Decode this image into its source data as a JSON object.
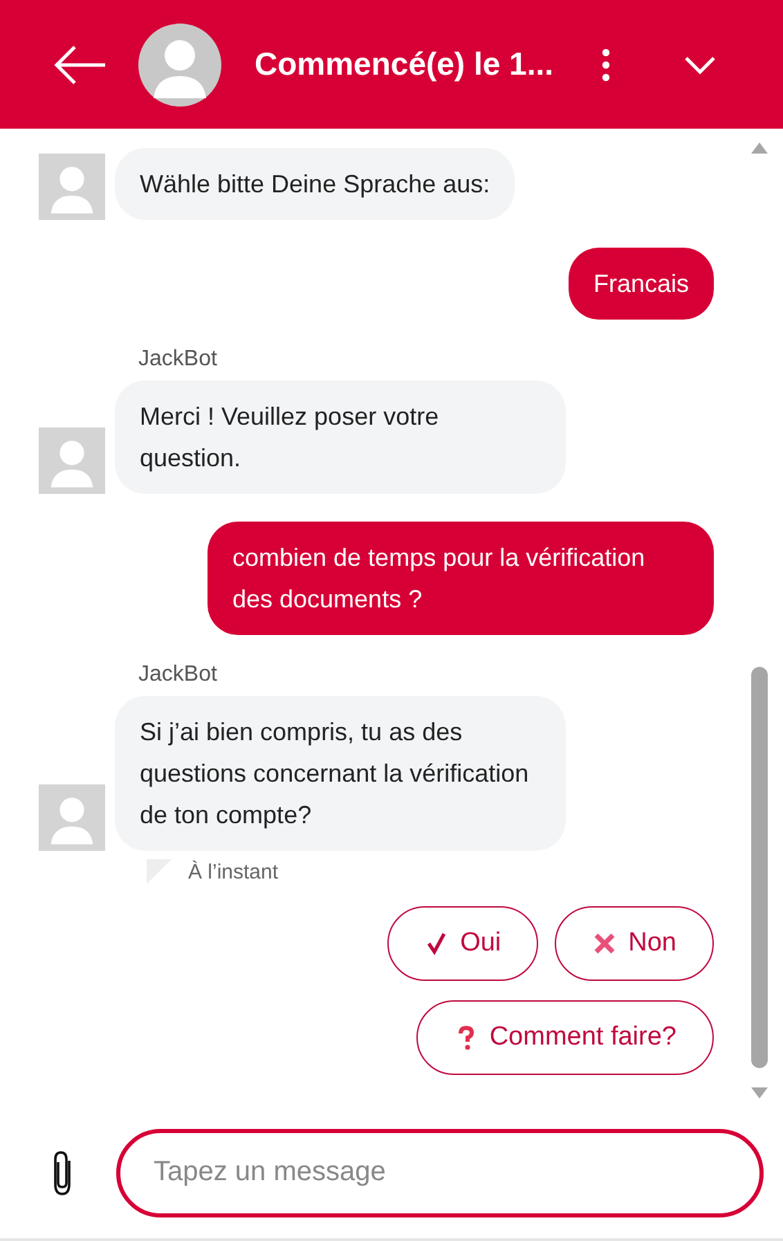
{
  "header": {
    "title": "Commencé(e) le 1..."
  },
  "messages": [
    {
      "kind": "bot",
      "text": "Wähle bitte Deine Sprache aus:"
    },
    {
      "kind": "user",
      "text": "Francais"
    },
    {
      "kind": "bot",
      "sender": "JackBot",
      "text": "Merci ! Veuillez poser votre question."
    },
    {
      "kind": "user",
      "text": "combien de temps pour la vérification des documents ?"
    },
    {
      "kind": "bot",
      "sender": "JackBot",
      "text": "Si j’ai bien compris, tu as des questions concernant la vérification de ton compte?",
      "time": "À l’instant"
    }
  ],
  "quick_replies": [
    {
      "kind": "check",
      "label": "Oui"
    },
    {
      "kind": "cross",
      "label": "Non"
    },
    {
      "kind": "question",
      "label": "Comment faire?"
    }
  ],
  "composer": {
    "placeholder": "Tapez un message"
  }
}
